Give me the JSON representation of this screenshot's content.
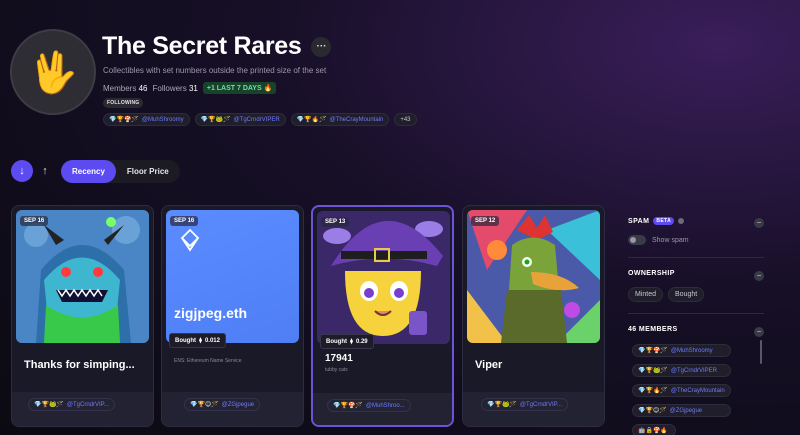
{
  "header": {
    "title": "The Secret Rares",
    "more_label": "···",
    "description": "Collectibles with set numbers outside the printed size of the set",
    "members_label": "Members",
    "members_count": "46",
    "followers_label": "Followers",
    "followers_count": "31",
    "growth_badge": "+1 LAST 7 DAYS 🔥",
    "following_label": "FOLLOWING",
    "avatar_icon": "vulcan-salute-icon",
    "top_members": [
      {
        "emojis": "💎🏆🍄🪄",
        "name": "@MuhShroomy"
      },
      {
        "emojis": "💎🏆🐸🪄",
        "name": "@TgCrndrVIPER"
      },
      {
        "emojis": "💎🏆🔥🪄",
        "name": "@TheCrayMountain"
      }
    ],
    "more_members": "+43"
  },
  "controls": {
    "sort_desc_icon": "↓",
    "sort_asc_icon": "↑",
    "tabs": [
      {
        "label": "Recency",
        "active": true
      },
      {
        "label": "Floor Price",
        "active": false
      }
    ]
  },
  "cards": [
    {
      "date": "SEP 16",
      "name": "Thanks for simping...",
      "subtitle": "",
      "price_label": "",
      "price": "",
      "owner_emojis": "💎🏆🐸🪄",
      "owner": "@TgCrndrVIP..."
    },
    {
      "date": "SEP 16",
      "name": "",
      "subtitle": "ENS: Ethereum Name Service",
      "image_text": "zigjpeg.eth",
      "price_label": "Bought",
      "price": "0.012",
      "owner_emojis": "💎🏆😊🪄",
      "owner": "@ZGjpegue"
    },
    {
      "date": "SEP 13",
      "name": "17941",
      "subtitle": "tubby cats",
      "price_label": "Bought",
      "price": "0.29",
      "owner_emojis": "💎🏆🍄🪄",
      "owner": "@MuhShroo..."
    },
    {
      "date": "SEP 12",
      "name": "Viper",
      "subtitle": "",
      "price_label": "",
      "price": "",
      "owner_emojis": "💎🏆🐸🪄",
      "owner": "@TgCrndrVIP..."
    }
  ],
  "sidebar": {
    "spam": {
      "title": "SPAM",
      "beta": "BETA",
      "toggle_label": "Show spam"
    },
    "ownership": {
      "title": "OWNERSHIP",
      "chips": [
        "Minted",
        "Bought"
      ]
    },
    "members": {
      "title": "46 MEMBERS",
      "list": [
        {
          "emojis": "💎🏆🍄🪄",
          "name": "@MuhShroomy"
        },
        {
          "emojis": "💎🏆🐸🪄",
          "name": "@TgCrndrVIPER"
        },
        {
          "emojis": "💎🏆🔥🪄",
          "name": "@TheCrayMountain"
        },
        {
          "emojis": "💎🏆😊🪄",
          "name": "@ZGjpegue"
        }
      ],
      "partial_row_emojis": "🤖🔒🍄🔥"
    },
    "collapse_icon": "−"
  },
  "colors": {
    "accent": "#5b4bf0",
    "link": "#6e7bff",
    "growth": "#6de09a"
  }
}
